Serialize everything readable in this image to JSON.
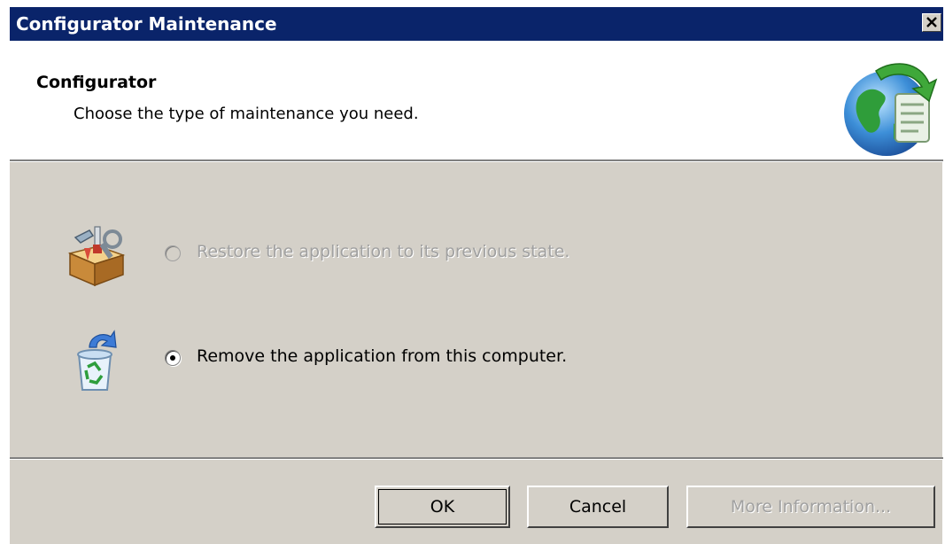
{
  "window": {
    "title": "Configurator Maintenance",
    "close_icon": "close-icon"
  },
  "header": {
    "title": "Configurator",
    "subtitle": "Choose the type of maintenance you need.",
    "icon": "globe-setup-icon"
  },
  "options": [
    {
      "label": "Restore the application to its previous state.",
      "selected": false,
      "enabled": false,
      "icon": "toolbox-repair-icon"
    },
    {
      "label": "Remove the application from this computer.",
      "selected": true,
      "enabled": true,
      "icon": "recycle-bin-icon"
    }
  ],
  "buttons": {
    "ok": "OK",
    "cancel": "Cancel",
    "more_info": "More Information..."
  },
  "colors": {
    "titlebar": "#0a246a",
    "dialog_face": "#d4d0c8",
    "disabled_text": "#a0a0a0"
  }
}
